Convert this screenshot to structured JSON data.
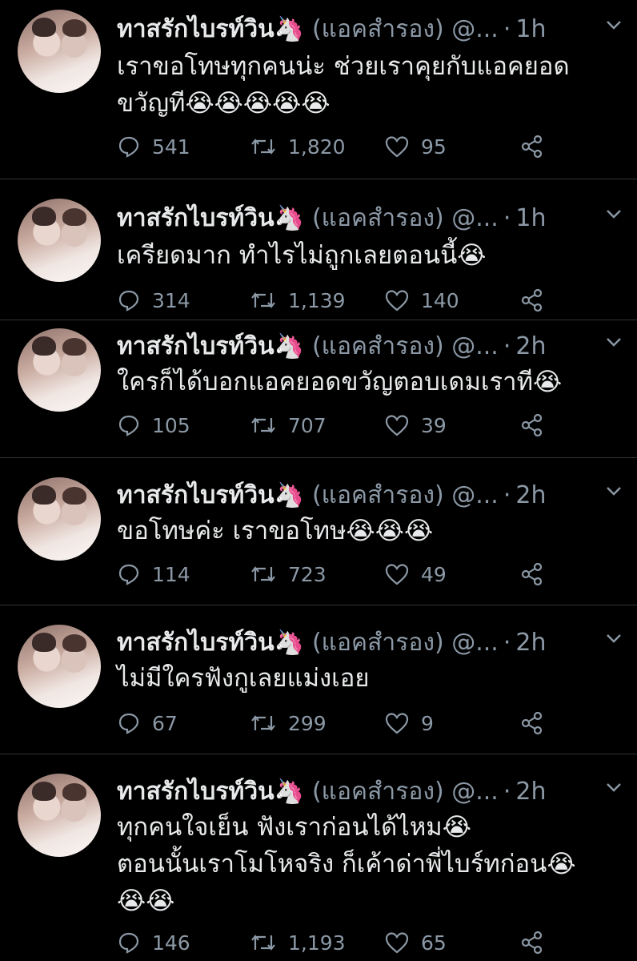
{
  "tweets": [
    {
      "name": "ทาสรักไบรท์วิน🦄",
      "handle": "(แอคสำรอง) @...",
      "time": "1h",
      "lines": [
        "เราขอโทษทุกคนน่ะ ช่วยเราคุยกับแอคยอด",
        "ขวัญที😭😭😭😭😭"
      ],
      "replies": "541",
      "retweets": "1,820",
      "likes": "95"
    },
    {
      "name": "ทาสรักไบรท์วิน🦄",
      "handle": "(แอคสำรอง) @...",
      "time": "1h",
      "lines": [
        "เครียดมาก ทำไรไม่ถูกเลยตอนนี้😭"
      ],
      "replies": "314",
      "retweets": "1,139",
      "likes": "140"
    },
    {
      "name": "ทาสรักไบรท์วิน🦄",
      "handle": "(แอคสำรอง) @...",
      "time": "2h",
      "lines": [
        "ใครก็ได้บอกแอคยอดขวัญตอบเดมเราที😭"
      ],
      "replies": "105",
      "retweets": "707",
      "likes": "39"
    },
    {
      "name": "ทาสรักไบรท์วิน🦄",
      "handle": "(แอคสำรอง) @...",
      "time": "2h",
      "lines": [
        "ขอโทษค่ะ เราขอโทษ😭😭😭"
      ],
      "replies": "114",
      "retweets": "723",
      "likes": "49"
    },
    {
      "name": "ทาสรักไบรท์วิน🦄",
      "handle": "(แอคสำรอง) @...",
      "time": "2h",
      "lines": [
        "ไม่มีใครฟังกูเลยแม่งเอย"
      ],
      "replies": "67",
      "retweets": "299",
      "likes": "9"
    },
    {
      "name": "ทาสรักไบรท์วิน🦄",
      "handle": "(แอคสำรอง) @...",
      "time": "2h",
      "lines": [
        "ทุกคนใจเย็น ฟังเราก่อนได้ไหม😭",
        "ตอนนั้นเราโมโหจริง ก็เค้าด่าพี่ไบร์ทก่อน😭",
        "😭😭"
      ],
      "replies": "146",
      "retweets": "1,193",
      "likes": "65"
    }
  ]
}
